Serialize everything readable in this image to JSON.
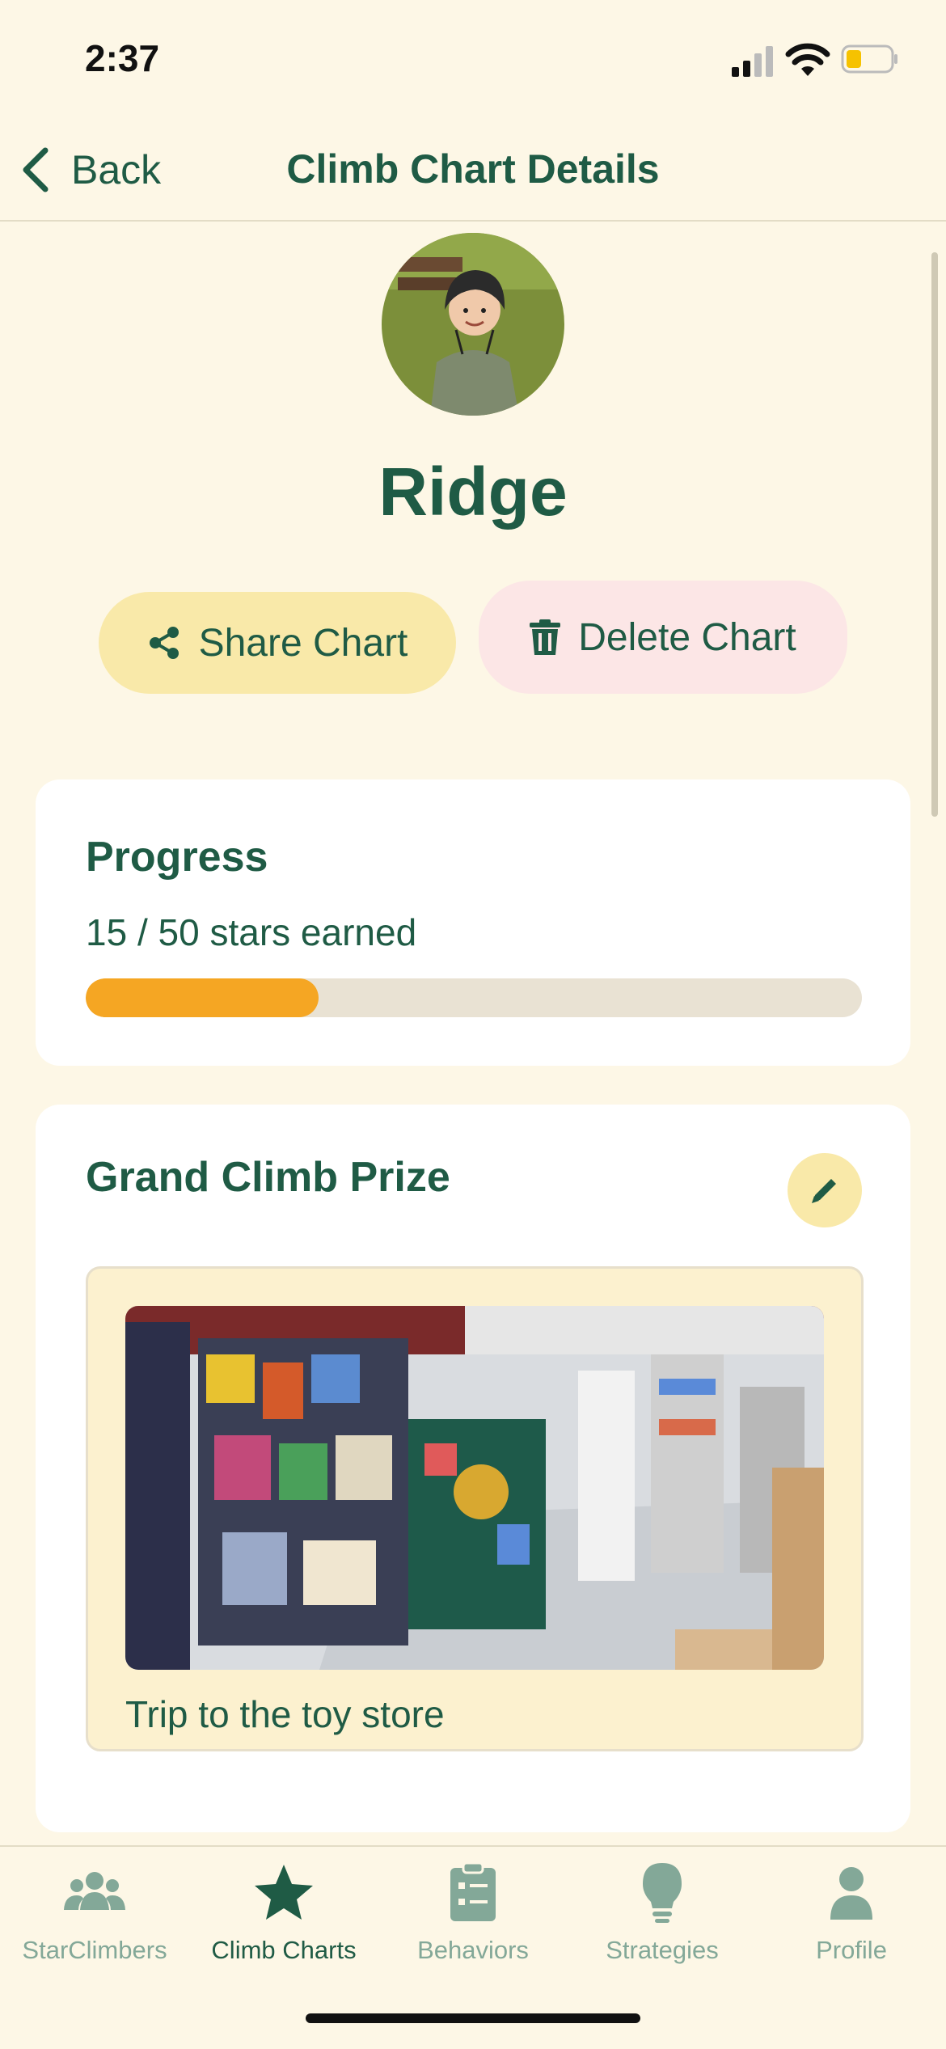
{
  "status_bar": {
    "time": "2:37",
    "battery_color": "#F6C200"
  },
  "nav": {
    "back_label": "Back",
    "title": "Climb Chart Details"
  },
  "profile": {
    "name": "Ridge"
  },
  "actions": {
    "share_label": "Share Chart",
    "delete_label": "Delete Chart"
  },
  "progress": {
    "title": "Progress",
    "summary": "15 / 50 stars earned",
    "earned": 15,
    "total": 50,
    "fill_color": "#F5A623"
  },
  "prize": {
    "title": "Grand Climb Prize",
    "caption": "Trip to the toy store"
  },
  "tabs": [
    {
      "label": "StarClimbers",
      "icon": "users-icon",
      "active": false
    },
    {
      "label": "Climb Charts",
      "icon": "star-icon",
      "active": true
    },
    {
      "label": "Behaviors",
      "icon": "clipboard-list-icon",
      "active": false
    },
    {
      "label": "Strategies",
      "icon": "lightbulb-icon",
      "active": false
    },
    {
      "label": "Profile",
      "icon": "person-icon",
      "active": false
    }
  ],
  "colors": {
    "accent": "#1F5B45",
    "background": "#FDF7E6",
    "inactive_tab": "#83A898"
  }
}
